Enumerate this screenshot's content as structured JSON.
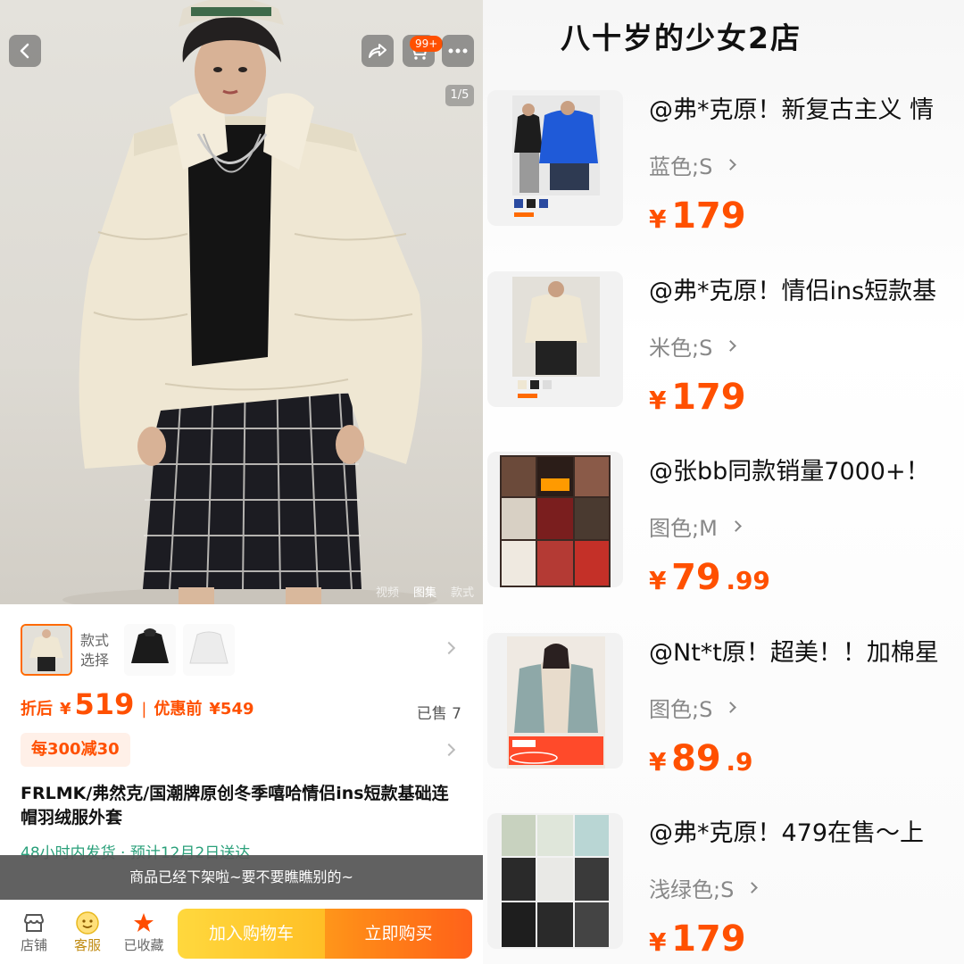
{
  "left": {
    "page_indicator": "1/5",
    "cart_badge": "99+",
    "gallery_tabs": [
      "视频",
      "图集",
      "款式"
    ],
    "style_label": "款式选择",
    "price": {
      "after_label": "折后",
      "currency": "¥",
      "after_value": "519",
      "separator": "|",
      "before_label": "优惠前",
      "before_value": "¥549"
    },
    "sold": "已售 7",
    "coupon": "每300减30",
    "product_title": "FRLMK/弗然克/国潮牌原创冬季嘻哈情侣ins短款基础连帽羽绒服外套",
    "shipping": "48小时内发货 · 预计12月2日送达",
    "offshelf_banner": "商品已经下架啦~要不要瞧瞧别的~",
    "nav": {
      "store": "店铺",
      "service": "客服",
      "favorited": "已收藏"
    },
    "add_to_cart": "加入购物车",
    "buy_now": "立即购买",
    "colors": {
      "accent": "#ff5000",
      "yellow": "#ffb400"
    }
  },
  "right": {
    "shop_title": "八十岁的少女2店",
    "items": [
      {
        "name": "@弗*克原！新复古主义 情",
        "sku": "蓝色;S",
        "currency": "¥",
        "price_int": "179",
        "price_dec": ""
      },
      {
        "name": "@弗*克原！情侣ins短款基",
        "sku": "米色;S",
        "currency": "¥",
        "price_int": "179",
        "price_dec": ""
      },
      {
        "name": "@张bb同款销量7000+！",
        "sku": "图色;M",
        "currency": "¥",
        "price_int": "79",
        "price_dec": ".99"
      },
      {
        "name": "@Nt*t原！超美！！加棉星",
        "sku": "图色;S",
        "currency": "¥",
        "price_int": "89",
        "price_dec": ".9"
      },
      {
        "name": "@弗*克原！479在售～上",
        "sku": "浅绿色;S",
        "currency": "¥",
        "price_int": "179",
        "price_dec": ""
      }
    ]
  }
}
